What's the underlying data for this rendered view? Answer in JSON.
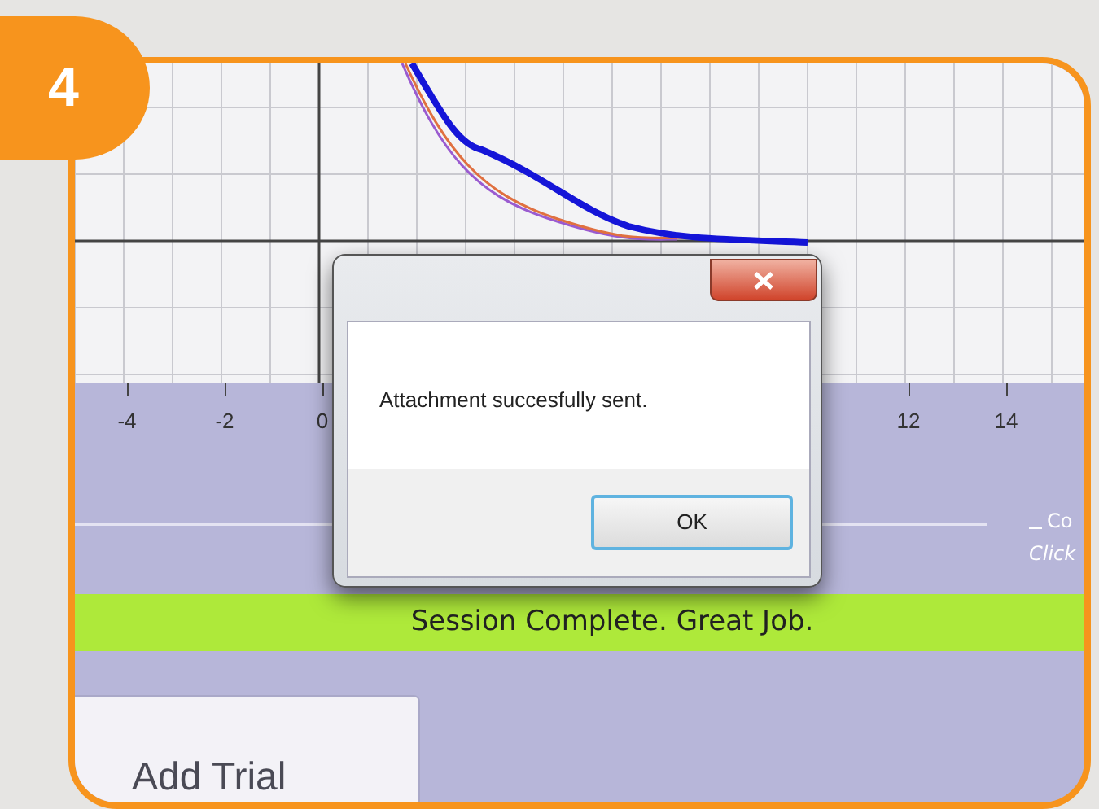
{
  "step_badge": "4",
  "graph": {
    "x_tick_labels": [
      "-4",
      "-2",
      "0",
      "12",
      "14"
    ],
    "legend": [
      "Co",
      "Click"
    ]
  },
  "status_banner": "Session Complete. Great Job.",
  "tabs": [
    {
      "label": "Add Trial"
    }
  ],
  "dialog": {
    "message": "Attachment succesfully sent.",
    "buttons": [
      "OK"
    ]
  }
}
